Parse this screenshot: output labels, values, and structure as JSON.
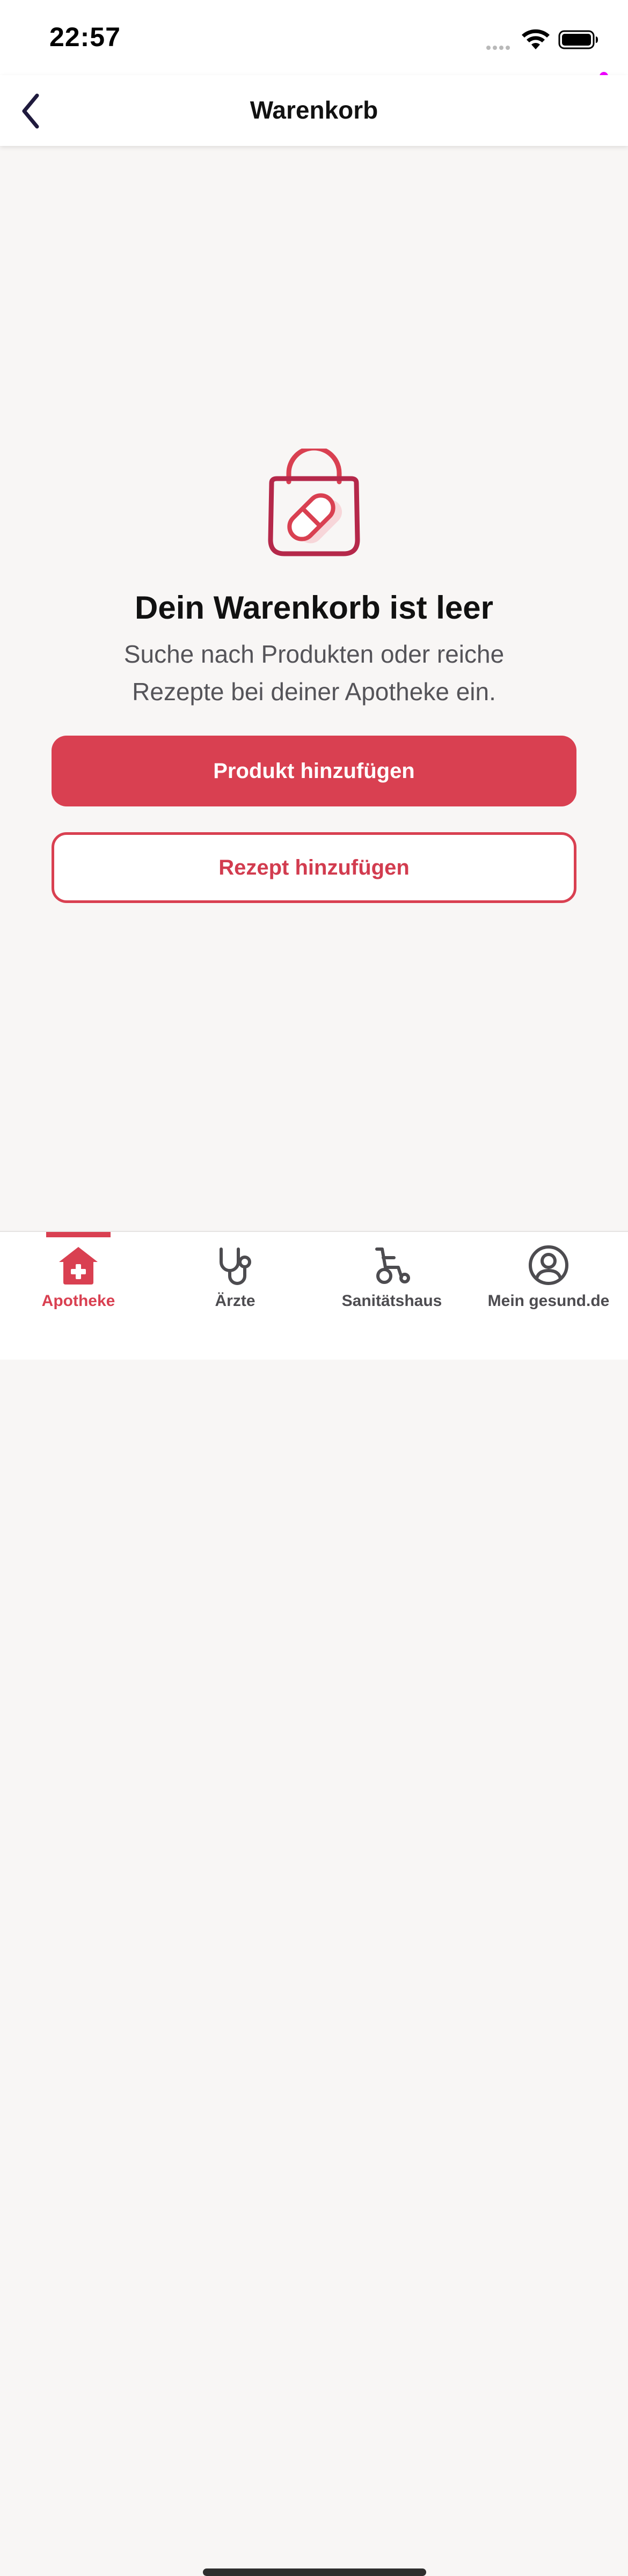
{
  "status_bar": {
    "time": "22:57"
  },
  "nav": {
    "title": "Warenkorb",
    "back_icon": "chevron-left-icon"
  },
  "empty_state": {
    "illustration": "shopping-bag-pill-icon",
    "title": "Dein Warenkorb ist leer",
    "subtitle": "Suche nach Produkten oder reiche Rezepte bei deiner Apotheke ein."
  },
  "actions": {
    "add_product_label": "Produkt hinzufügen",
    "add_prescription_label": "Rezept hinzufügen"
  },
  "tab_bar": {
    "items": [
      {
        "label": "Apotheke",
        "icon": "pharmacy-house-icon",
        "active": true
      },
      {
        "label": "Ärzte",
        "icon": "stethoscope-icon",
        "active": false
      },
      {
        "label": "Sanitätshaus",
        "icon": "wheelchair-icon",
        "active": false
      },
      {
        "label": "Mein gesund.de",
        "icon": "user-circle-icon",
        "active": false
      }
    ]
  },
  "colors": {
    "accent": "#d94051",
    "accent_dark": "#b5284a",
    "background": "#f8f6f5",
    "text_primary": "#111111",
    "text_secondary": "#555459"
  }
}
